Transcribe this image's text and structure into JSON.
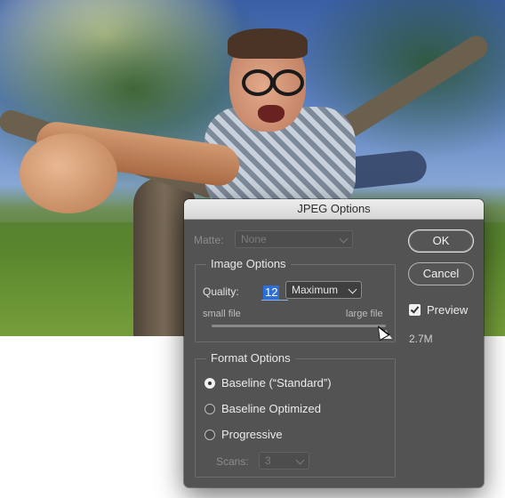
{
  "dialog": {
    "title": "JPEG Options",
    "matte": {
      "label": "Matte:",
      "value": "None"
    },
    "image_options": {
      "title": "Image Options",
      "quality_label": "Quality:",
      "quality_value": "12",
      "quality_preset": "Maximum",
      "slider_min_label": "small file",
      "slider_max_label": "large file",
      "slider_level_fraction": 1.0
    },
    "format_options": {
      "title": "Format Options",
      "options": [
        {
          "label": "Baseline (“Standard”)",
          "selected": true
        },
        {
          "label": "Baseline Optimized",
          "selected": false
        },
        {
          "label": "Progressive",
          "selected": false
        }
      ],
      "scans_label": "Scans:",
      "scans_value": "3"
    },
    "buttons": {
      "ok": "OK",
      "cancel": "Cancel"
    },
    "preview": {
      "label": "Preview",
      "checked": true
    },
    "file_size": "2.7M"
  },
  "colors": {
    "dialog_bg": "#535353",
    "titlebar_bg": "#e3e3e3",
    "selection_blue": "#2d6fd6"
  },
  "icons": [
    "chevron-down-icon",
    "checkmark-icon",
    "slider-thumb-icon",
    "mouse-cursor-icon"
  ]
}
